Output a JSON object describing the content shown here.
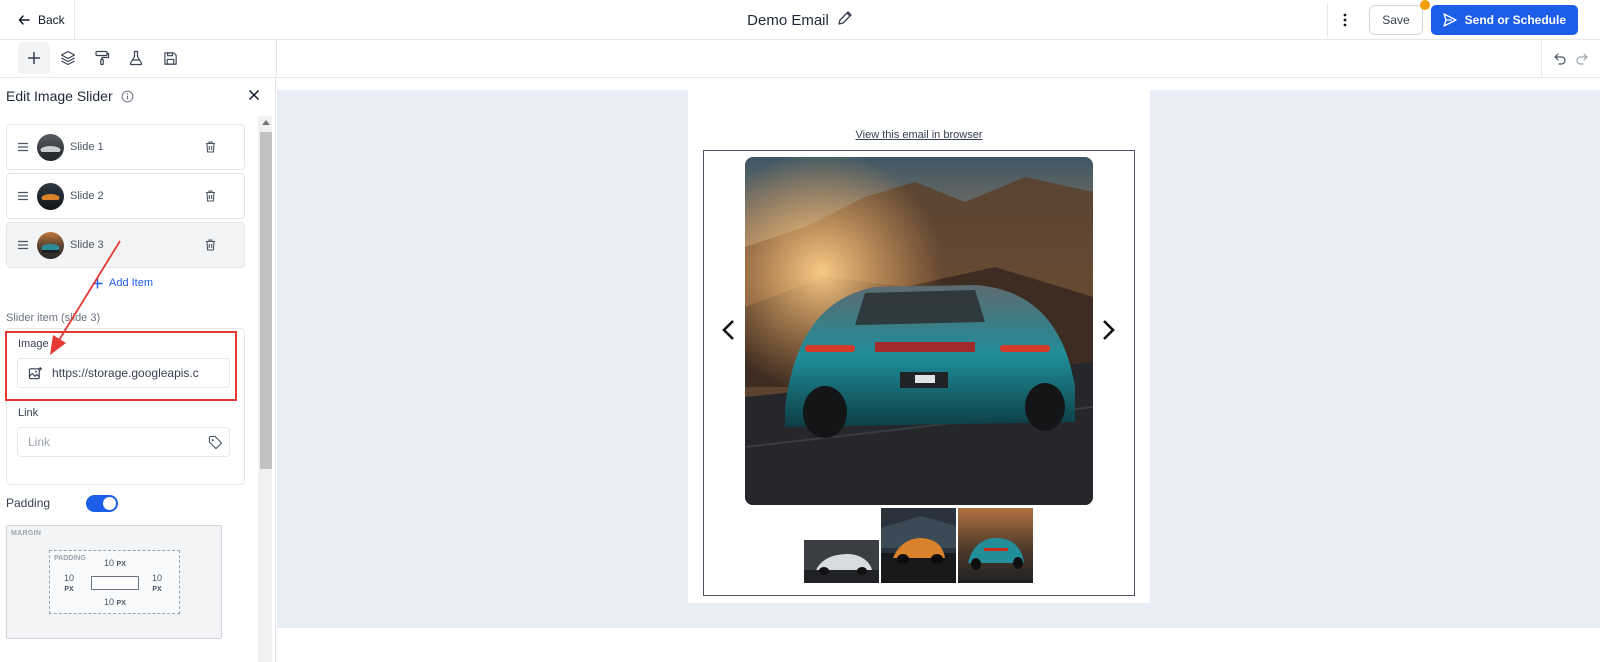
{
  "header": {
    "back_label": "Back",
    "title": "Demo Email",
    "save_label": "Save",
    "send_label": "Send or Schedule"
  },
  "panel": {
    "title": "Edit Image Slider",
    "slides": [
      {
        "label": "Slide 1"
      },
      {
        "label": "Slide 2"
      },
      {
        "label": "Slide 3"
      }
    ],
    "add_item_label": "Add Item",
    "section_label": "Slider item (slide 3)",
    "image_label": "Image",
    "image_value": "https://storage.googleapis.c",
    "link_label": "Link",
    "link_placeholder": "Link",
    "padding_label": "Padding",
    "padding_enabled": true,
    "box_model": {
      "margin_label": "MARGIN",
      "padding_label": "PADDING",
      "top": "10",
      "bottom": "10",
      "left": "10",
      "right": "10",
      "unit": "PX"
    }
  },
  "email": {
    "browser_link": "View this email in browser"
  },
  "colors": {
    "accent": "#1d5ee8",
    "highlight": "#e53935",
    "notification_dot": "#f59e0b",
    "canvas_bg": "#e9edf5"
  }
}
